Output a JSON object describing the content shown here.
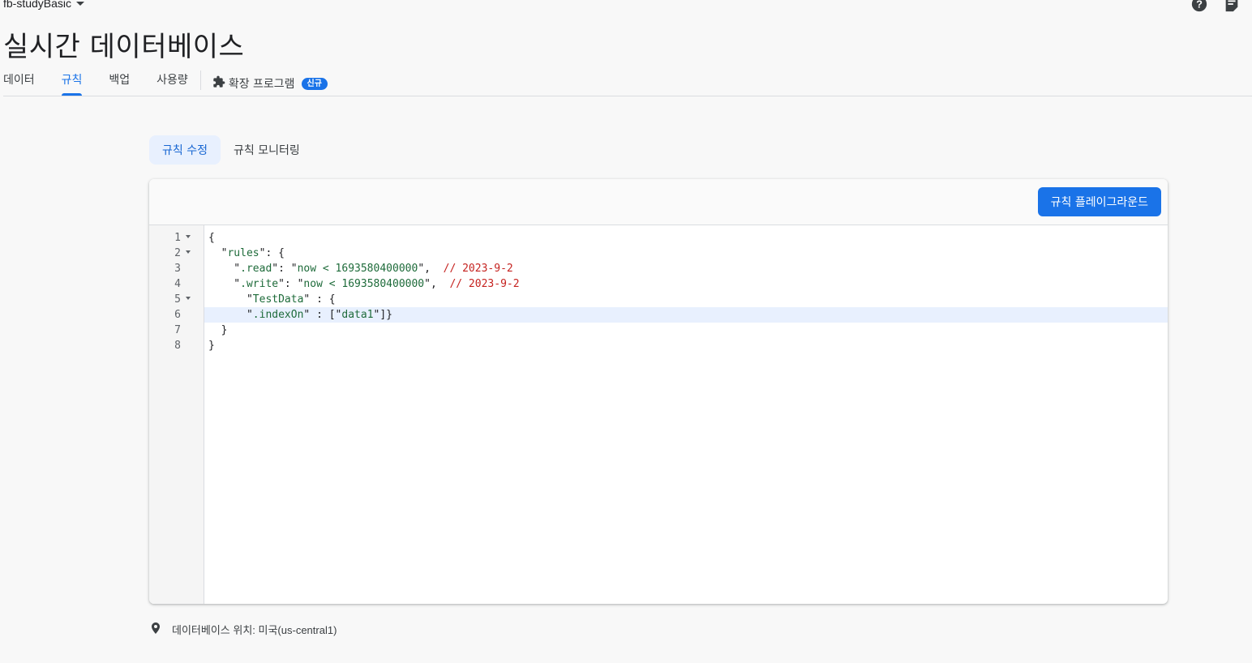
{
  "header": {
    "project_name": "fb-studyBasic",
    "page_title": "실시간 데이터베이스",
    "icons": [
      "help-icon",
      "feedback-icon"
    ]
  },
  "tabs": [
    {
      "label": "데이터",
      "active": false
    },
    {
      "label": "규칙",
      "active": true
    },
    {
      "label": "백업",
      "active": false
    },
    {
      "label": "사용량",
      "active": false
    }
  ],
  "extensions_tab": {
    "label": "확장 프로그램",
    "badge": "신규",
    "icon": "extension-icon"
  },
  "subtabs": [
    {
      "label": "규칙 수정",
      "active": true
    },
    {
      "label": "규칙 모니터링",
      "active": false
    }
  ],
  "editor": {
    "playground_button": "규칙 플레이그라운드",
    "lines": [
      {
        "num": "1",
        "fold": true,
        "text": "{"
      },
      {
        "num": "2",
        "fold": true,
        "text": "  \"rules\": {"
      },
      {
        "num": "3",
        "fold": false,
        "text": "    \".read\": \"now < 1693580400000\",  // 2023-9-2"
      },
      {
        "num": "4",
        "fold": false,
        "text": "    \".write\": \"now < 1693580400000\",  // 2023-9-2"
      },
      {
        "num": "5",
        "fold": true,
        "text": "      \"TestData\" : {"
      },
      {
        "num": "6",
        "fold": false,
        "text": "      \".indexOn\" : [\"data1\"]}"
      },
      {
        "num": "7",
        "fold": false,
        "text": "  }"
      },
      {
        "num": "8",
        "fold": false,
        "text": "}"
      }
    ],
    "highlighted_line": 6
  },
  "footer": {
    "location_label": "데이터베이스 위치: 미국(us-central1)",
    "icon": "location-pin-icon"
  },
  "colors": {
    "accent": "#1a73e8",
    "string": "#1e6b3a",
    "comment": "#c5221f"
  }
}
